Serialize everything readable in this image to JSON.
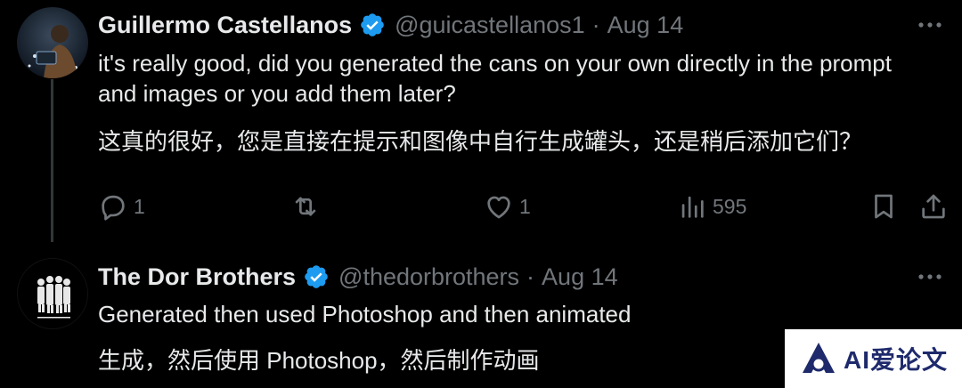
{
  "tweet1": {
    "author_name": "Guillermo Castellanos",
    "handle": "@guicastellanos1",
    "separator": "·",
    "date": "Aug 14",
    "text_en": "it's really good, did you generated the cans on your own directly in the prompt and images or you add them later?",
    "text_zh": "这真的很好，您是直接在提示和图像中自行生成罐头，还是稍后添加它们？",
    "actions": {
      "reply_count": "1",
      "repost_count": "",
      "like_count": "1",
      "views_count": "595"
    }
  },
  "tweet2": {
    "author_name": "The Dor Brothers",
    "handle": "@thedorbrothers",
    "separator": "·",
    "date": "Aug 14",
    "text_en": "Generated then used Photoshop and then animated",
    "text_zh": "生成，然后使用 Photoshop，然后制作动画"
  },
  "watermark": {
    "text": "AI爱论文"
  },
  "colors": {
    "background": "#000000",
    "text_primary": "#e7e9ea",
    "text_secondary": "#71767b",
    "verified_blue": "#1d9bf0",
    "thread_line": "#333639"
  }
}
